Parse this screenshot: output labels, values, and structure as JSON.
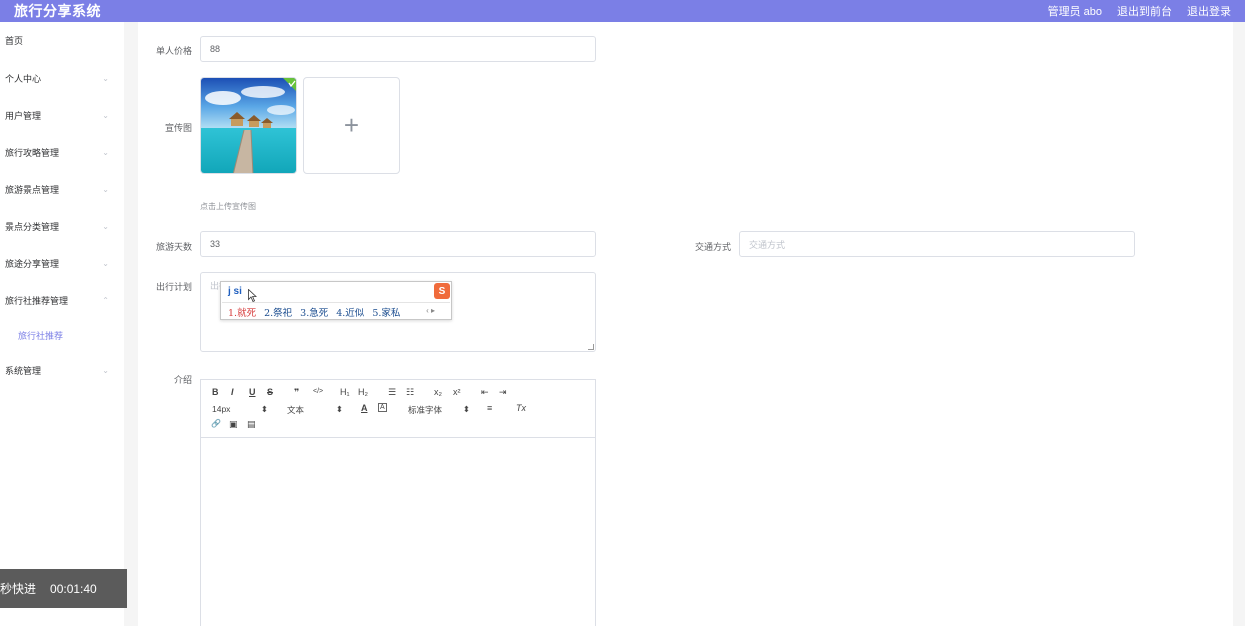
{
  "app": {
    "title": "旅行分享系统"
  },
  "header": {
    "user_label": "管理员 abo",
    "back_label": "退出到前台",
    "logout_label": "退出登录"
  },
  "sidebar": {
    "items": [
      {
        "label": "首页",
        "has_chevron": false
      },
      {
        "label": "个人中心",
        "has_chevron": true
      },
      {
        "label": "用户管理",
        "has_chevron": true
      },
      {
        "label": "旅行攻略管理",
        "has_chevron": true
      },
      {
        "label": "旅游景点管理",
        "has_chevron": true
      },
      {
        "label": "景点分类管理",
        "has_chevron": true
      },
      {
        "label": "旅途分享管理",
        "has_chevron": true
      },
      {
        "label": "旅行社推荐管理",
        "has_chevron": true,
        "expanded": true
      },
      {
        "label": "系统管理",
        "has_chevron": true
      }
    ],
    "sub_item": "旅行社推荐",
    "chevron_down": "⌄",
    "chevron_up": "⌃"
  },
  "form": {
    "price": {
      "label": "单人价格",
      "value": "88"
    },
    "cover": {
      "label": "宣传图",
      "add_symbol": "+",
      "hint": "点击上传宣传图"
    },
    "days": {
      "label": "旅游天数",
      "value": "33"
    },
    "transport": {
      "label": "交通方式",
      "placeholder": "交通方式"
    },
    "plan": {
      "label": "出行计划",
      "placeholder": "出行计划"
    },
    "intro": {
      "label": "介绍"
    }
  },
  "ime": {
    "composition": "j si",
    "logo": "S",
    "candidates": [
      "1.就死",
      "2.祭祀",
      "3.急死",
      "4.近似",
      "5.家私"
    ],
    "arrows": "‹ ▸"
  },
  "editor": {
    "buttons_row1": [
      "B",
      "I",
      "U",
      "S",
      "❞",
      "</>",
      "H₁",
      "H₂",
      "☰",
      "☷",
      "x₂",
      "x²",
      "⇤",
      "⇥"
    ],
    "font_size": "14px",
    "text_type": "文本",
    "font_family": "标准字体",
    "color_icon": "A",
    "bg_icon": "A",
    "align_icon": "≡",
    "clear_icon": "Tx",
    "buttons_row3": [
      "🔗",
      "▣",
      "▤"
    ]
  },
  "timer": {
    "label": "秒快进",
    "time": "00:01:40"
  },
  "colors": {
    "accent": "#7b7fe6",
    "border": "#dcdfe6"
  }
}
